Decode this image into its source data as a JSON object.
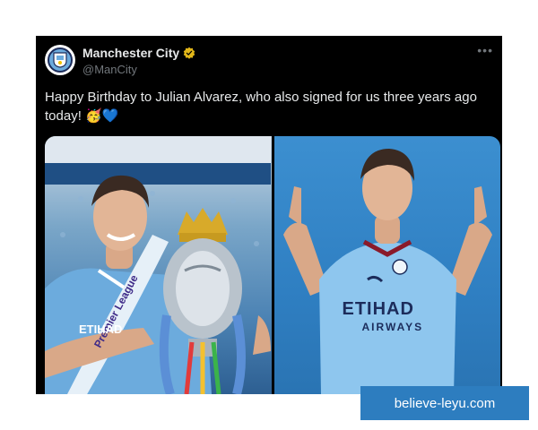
{
  "account": {
    "display_name": "Manchester City",
    "handle": "@ManCity",
    "verified_icon": "verified-gold-badge-icon",
    "avatar_icon": "man-city-crest-icon"
  },
  "menu": {
    "more_label": "•••"
  },
  "tweet": {
    "text": "Happy Birthday to Julian Alvarez, who also signed for us three years ago today!",
    "emojis": "🥳💙"
  },
  "media": {
    "left_image": {
      "icon": "player-holding-trophy-photo",
      "sash_text": "Premier League",
      "kit_text": "ETIHAD"
    },
    "right_image": {
      "icon": "player-pointing-photo",
      "sponsor_line1": "ETIHAD",
      "sponsor_line2": "AIRWAYS"
    }
  },
  "watermark": {
    "text": "believe-leyu.com"
  },
  "colors": {
    "tweet_bg": "#000000",
    "text": "#e7e9ea",
    "muted": "#71767b",
    "city_blue": "#6cabdd",
    "verified_gold": "#e2b719",
    "watermark_bg": "#2d7dbf"
  }
}
